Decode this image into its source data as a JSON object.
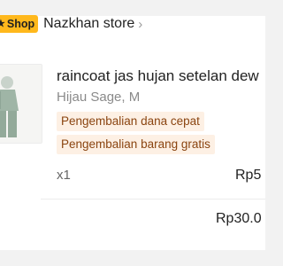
{
  "store": {
    "badge_icon": "star-icon",
    "badge_label": "Shop",
    "name": "Nazkhan store",
    "chevron_icon": "chevron-right-icon"
  },
  "colors": {
    "badge_bg": "#ffb81c",
    "tag_bg": "#fdf0e4",
    "tag_text": "#8a4410"
  },
  "product": {
    "title": "raincoat jas hujan setelan dew",
    "variant": "Hijau Sage, M",
    "tags": [
      "Pengembalian dana cepat",
      "Pengembalian barang gratis"
    ],
    "quantity": "x1",
    "price": "Rp5"
  },
  "summary": {
    "total": "Rp30.0"
  }
}
